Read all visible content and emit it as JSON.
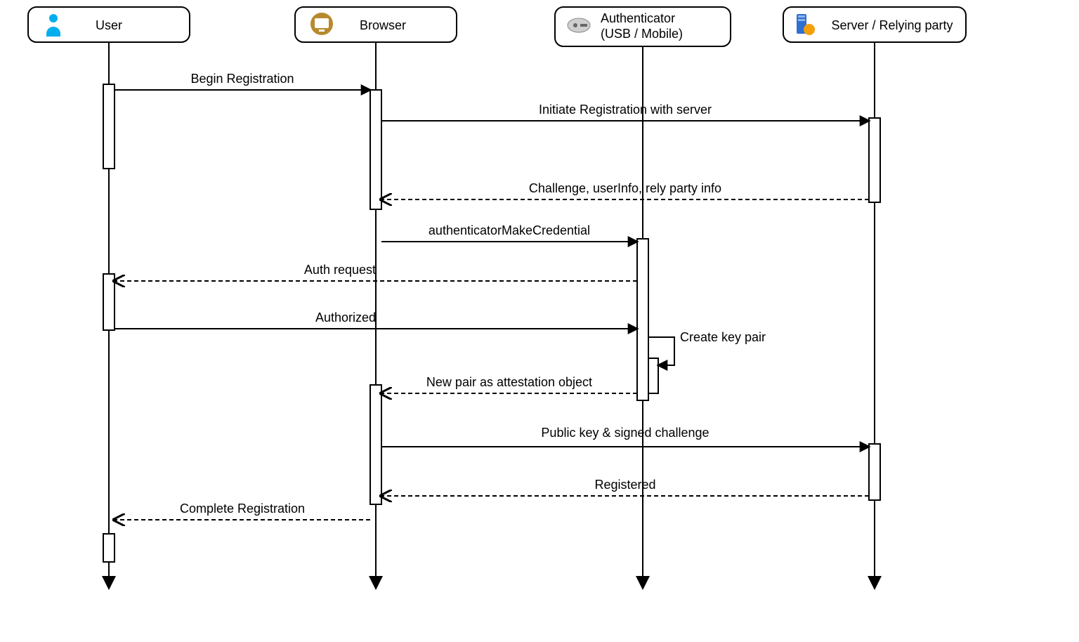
{
  "participants": {
    "user": {
      "label": "User"
    },
    "browser": {
      "label": "Browser"
    },
    "auth": {
      "label_line1": "Authenticator",
      "label_line2": "(USB / Mobile)"
    },
    "server": {
      "label": "Server / Relying party"
    }
  },
  "messages": {
    "begin_registration": "Begin Registration",
    "initiate_registration": "Initiate Registration with server",
    "challenge_info": "Challenge, userInfo, rely party info",
    "make_credential": "authenticatorMakeCredential",
    "auth_request": "Auth request",
    "authorized": "Authorized",
    "create_key_pair": "Create key pair",
    "attestation_object": "New pair as attestation object",
    "public_key_challenge": "Public key & signed challenge",
    "registered": "Registered",
    "complete_registration": "Complete Registration"
  }
}
